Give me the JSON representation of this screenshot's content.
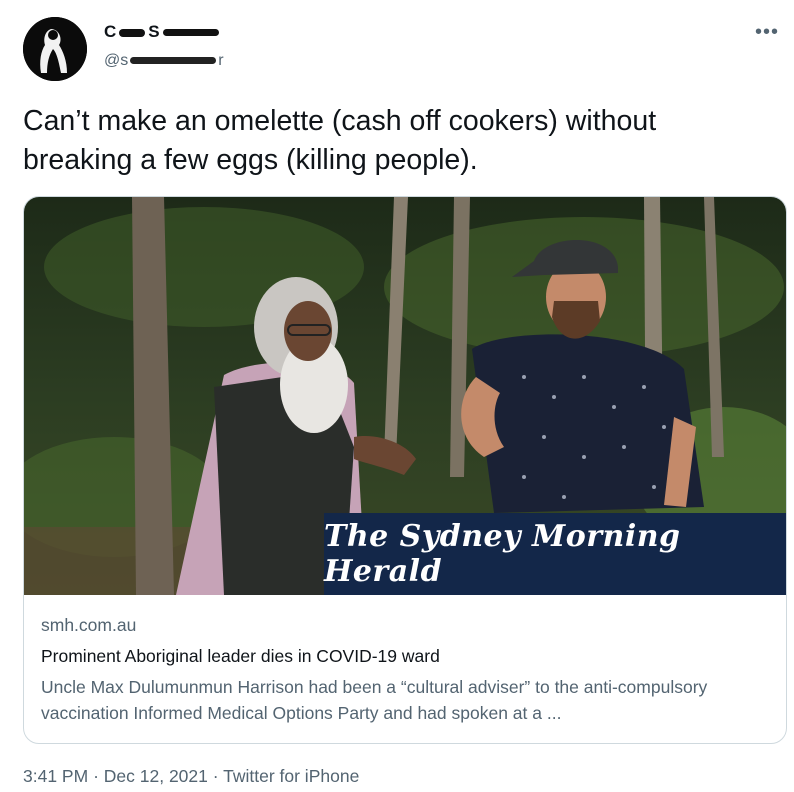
{
  "user": {
    "display_name_start": "C",
    "display_name_mid": "S",
    "handle_prefix": "@s",
    "handle_suffix": "r"
  },
  "tweet": {
    "text": "Can’t make an omelette (cash off cookers) without\nbreaking a few eggs (killing people)."
  },
  "card": {
    "masthead": "The Sydney Morning Herald",
    "domain": "smh.com.au",
    "title": "Prominent Aboriginal leader dies in COVID-19 ward",
    "description": "Uncle Max Dulumunmun Harrison had been a “cultural adviser” to the anti-compulsory vaccination Informed Medical Options Party and had spoken at a ..."
  },
  "meta": {
    "time": "3:41 PM",
    "date": "Dec 12, 2021",
    "source": "Twitter for iPhone"
  },
  "icons": {
    "more": "more-horizontal-icon"
  },
  "colors": {
    "masthead_bg": "#132749",
    "secondary_text": "#536471",
    "border": "#cfd9de"
  }
}
